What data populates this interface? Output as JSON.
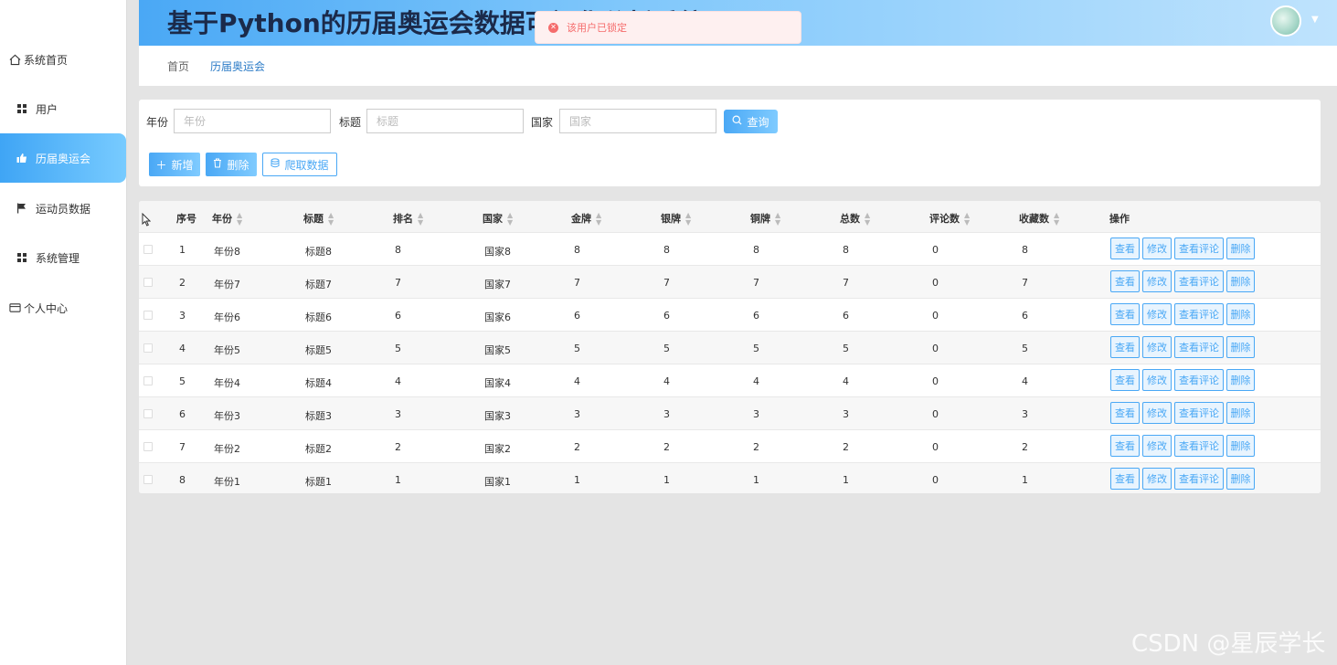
{
  "header": {
    "title": "基于Python的历届奥运会数据可视化分析系统"
  },
  "toast": {
    "message": "该用户已锁定"
  },
  "sidebar": {
    "items": [
      {
        "label": "系统首页",
        "icon": "home-icon"
      },
      {
        "label": "用户",
        "icon": "grid-icon"
      },
      {
        "label": "历届奥运会",
        "icon": "thumb-icon"
      },
      {
        "label": "运动员数据",
        "icon": "flag-icon"
      },
      {
        "label": "系统管理",
        "icon": "grid-icon"
      },
      {
        "label": "个人中心",
        "icon": "card-icon"
      }
    ],
    "active": "历届奥运会"
  },
  "breadcrumb": {
    "home": "首页",
    "current": "历届奥运会"
  },
  "search": {
    "year_label": "年份",
    "year_placeholder": "年份",
    "title_label": "标题",
    "title_placeholder": "标题",
    "country_label": "国家",
    "country_placeholder": "国家",
    "query_label": "查询"
  },
  "actions": {
    "add_label": "新增",
    "delete_label": "删除",
    "crawl_label": "爬取数据"
  },
  "table": {
    "headers": [
      "序号",
      "年份",
      "标题",
      "排名",
      "国家",
      "金牌",
      "银牌",
      "铜牌",
      "总数",
      "评论数",
      "收藏数",
      "操作"
    ],
    "op_labels": {
      "view": "查看",
      "edit": "修改",
      "comments": "查看评论",
      "delete": "删除"
    },
    "rows": [
      [
        "1",
        "年份8",
        "标题8",
        "8",
        "国家8",
        "8",
        "8",
        "8",
        "8",
        "0",
        "8"
      ],
      [
        "2",
        "年份7",
        "标题7",
        "7",
        "国家7",
        "7",
        "7",
        "7",
        "7",
        "0",
        "7"
      ],
      [
        "3",
        "年份6",
        "标题6",
        "6",
        "国家6",
        "6",
        "6",
        "6",
        "6",
        "0",
        "6"
      ],
      [
        "4",
        "年份5",
        "标题5",
        "5",
        "国家5",
        "5",
        "5",
        "5",
        "5",
        "0",
        "5"
      ],
      [
        "5",
        "年份4",
        "标题4",
        "4",
        "国家4",
        "4",
        "4",
        "4",
        "4",
        "0",
        "4"
      ],
      [
        "6",
        "年份3",
        "标题3",
        "3",
        "国家3",
        "3",
        "3",
        "3",
        "3",
        "0",
        "3"
      ],
      [
        "7",
        "年份2",
        "标题2",
        "2",
        "国家2",
        "2",
        "2",
        "2",
        "2",
        "0",
        "2"
      ],
      [
        "8",
        "年份1",
        "标题1",
        "1",
        "国家1",
        "1",
        "1",
        "1",
        "1",
        "0",
        "1"
      ]
    ]
  },
  "watermark": "CSDN @星辰学长",
  "colors": {
    "accent": "#4aa8f5",
    "error": "#f56c6c"
  }
}
